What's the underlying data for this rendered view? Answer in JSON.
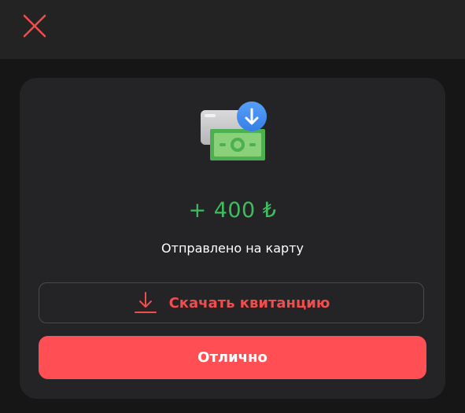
{
  "topbar": {
    "close_icon": "close-icon"
  },
  "card": {
    "illustration_icon": "money-transfer-icon",
    "amount": "+ 400 ₺",
    "status_text": "Отправлено на карту",
    "download_button": {
      "label": "Скачать квитанцию",
      "icon": "download-icon"
    },
    "ok_button": {
      "label": "Отлично"
    }
  },
  "colors": {
    "accent": "#ff4f55",
    "amount": "#3ebd5e",
    "background": "#161616",
    "card": "#242426"
  }
}
